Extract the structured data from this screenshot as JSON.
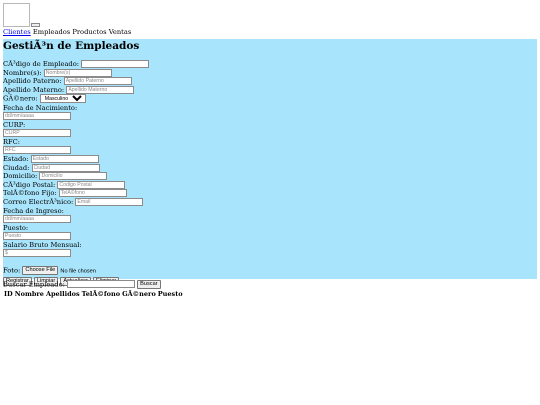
{
  "nav": {
    "links": [
      "Clientes",
      "Empleados",
      "Productos",
      "Ventas"
    ]
  },
  "form": {
    "title": "GestiÃ³n de Empleados",
    "fields": {
      "codigo": {
        "label": "CÃ³digo de Empleado:",
        "placeholder": ""
      },
      "nombres": {
        "label": "Nombre(s):",
        "placeholder": "Nombre(s)"
      },
      "apellido_paterno": {
        "label": "Apellido Paterno:",
        "placeholder": "Apellido Paterno"
      },
      "apellido_materno": {
        "label": "Apellido Materno:",
        "placeholder": "Apellido Materno"
      },
      "genero": {
        "label": "GÃ©nero:",
        "selected": "Masculino"
      },
      "fecha_nacimiento": {
        "label": "Fecha de Nacimiento:",
        "placeholder": "dd/mm/aaaa"
      },
      "curp": {
        "label": "CURP:",
        "placeholder": "CURP"
      },
      "rfc": {
        "label": "RFC:",
        "placeholder": "RFC"
      },
      "estado": {
        "label": "Estado:",
        "placeholder": "Estado"
      },
      "ciudad": {
        "label": "Ciudad:",
        "placeholder": "Ciudad"
      },
      "domicilio": {
        "label": "Domicilio:",
        "placeholder": "Domicilio"
      },
      "codigo_postal": {
        "label": "CÃ³digo Postal:",
        "placeholder": "Codigo Postal"
      },
      "telefono": {
        "label": "TelÃ©fono Fijo:",
        "placeholder": "TelÃ©fono"
      },
      "correo": {
        "label": "Correo ElectrÃ³nico:",
        "placeholder": "Email"
      },
      "fecha_ingreso": {
        "label": "Fecha de Ingreso:",
        "placeholder": "dd/mm/aaaa"
      },
      "puesto": {
        "label": "Puesto:",
        "placeholder": "Puesto"
      },
      "salario": {
        "label": "Salario Bruto Mensual:",
        "placeholder": "$"
      },
      "foto": {
        "label": "Foto:",
        "button": "Choose File",
        "status": "No file chosen"
      }
    },
    "buttons": {
      "registrar": "Registrar",
      "limpiar": "Limpiar",
      "actualizar": "Actualizar",
      "eliminar": "Eliminar"
    }
  },
  "search": {
    "label": "Buscar Empleado:",
    "placeholder": "",
    "button": "Buscar"
  },
  "table": {
    "headers": [
      "ID",
      "Nombre",
      "Apellidos",
      "TelÃ©fono",
      "GÃ©nero",
      "Puesto"
    ]
  }
}
